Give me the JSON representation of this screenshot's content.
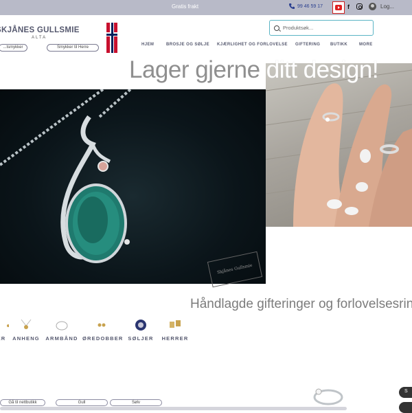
{
  "topbar": {
    "free_shipping": "Gratis frakt",
    "phone": "99 46 59 17",
    "login": "Log..."
  },
  "brand": {
    "name": "SKJÅNES GULLSMIE",
    "location": "ALTA",
    "btn_left": "...tsmykker",
    "btn_right": "Smykker til Herre"
  },
  "search": {
    "placeholder": "Produktsøk..."
  },
  "nav": {
    "items": [
      {
        "label": "HJEM"
      },
      {
        "label": "BROSJE OG SØLJE"
      },
      {
        "label": "KJÆRLIGHET OG FORLOVELSE"
      },
      {
        "label": "GIFTERING"
      },
      {
        "label": "BUTIKK"
      },
      {
        "label": "MORE"
      }
    ]
  },
  "hero": {
    "title_part1": "Lager gjerne",
    "title_part2": "ditt design!",
    "watermark": "Skjånes Gullsmie"
  },
  "section": {
    "subtitle": "Håndlagde gifteringer og forlovelsesrin"
  },
  "categories": [
    {
      "label": "ER"
    },
    {
      "label": "ANHENG"
    },
    {
      "label": "ARMBÅND"
    },
    {
      "label": "ØREDOBBER"
    },
    {
      "label": "SØLJER"
    },
    {
      "label": "HERRER"
    }
  ],
  "bottom": {
    "btn1": "Gå til nettbutikk",
    "btn2": "Gull",
    "btn3": "Sølv",
    "dark_btn": "S"
  },
  "colors": {
    "accent": "#5ab4c4",
    "nav_text": "#55586e",
    "topbar_bg": "#b8bac8"
  }
}
